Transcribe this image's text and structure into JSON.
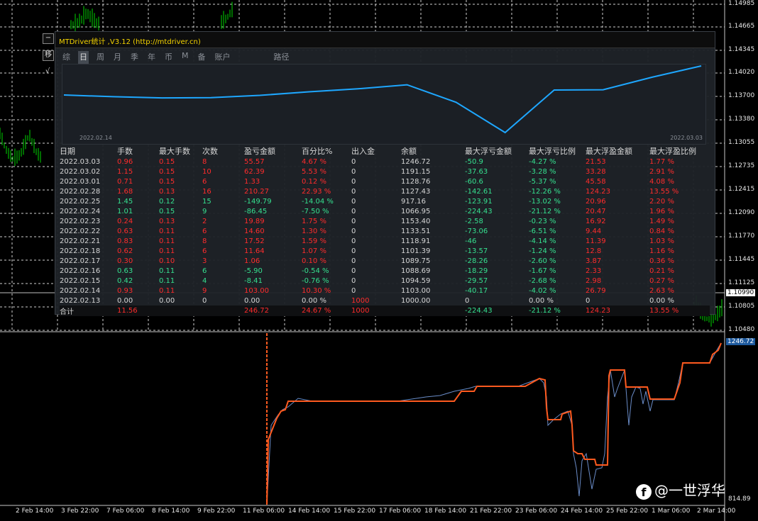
{
  "price_axis": {
    "labels": [
      "1.14985",
      "1.14665",
      "1.14345",
      "1.14020",
      "1.13700",
      "1.13380",
      "1.13055",
      "1.12735",
      "1.12415",
      "1.12090",
      "1.11770",
      "1.11445",
      "1.11125",
      "1.10805",
      "1.10480"
    ],
    "current_price": "1.10990"
  },
  "equity_axis": {
    "current": "1246.72",
    "min": "814.89"
  },
  "time_axis": [
    "2 Feb 14:00",
    "3 Feb 22:00",
    "7 Feb 06:00",
    "8 Feb 14:00",
    "9 Feb 22:00",
    "11 Feb 06:00",
    "14 Feb 14:00",
    "15 Feb 22:00",
    "17 Feb 06:00",
    "18 Feb 14:00",
    "21 Feb 22:00",
    "23 Feb 06:00",
    "24 Feb 14:00",
    "25 Feb 22:00",
    "1 Mar 06:00",
    "2 Mar 14:00"
  ],
  "side_buttons": [
    "−",
    "移",
    "√"
  ],
  "panel": {
    "title": "MTDriver统计 ,V3.12 (http://mtdriver.cn)",
    "tabs": [
      "综",
      "日",
      "周",
      "月",
      "季",
      "年",
      "币",
      "M",
      "备",
      "账户",
      "路径"
    ],
    "active_tab": "日",
    "mini_chart": {
      "start_date": "2022.02.14",
      "end_date": "2022.03.03",
      "line_color": "#1ea7ff"
    },
    "table": {
      "headers": [
        "日期",
        "手数",
        "最大手数",
        "次数",
        "盈亏金额",
        "百分比%",
        "出入金",
        "余额",
        "最大浮亏金额",
        "最大浮亏比例",
        "最大浮盈金额",
        "最大浮盈比例"
      ],
      "rows": [
        {
          "cells": [
            "2022.03.03",
            "0.96",
            "0.15",
            "8",
            "55.57",
            "4.67 %",
            "0",
            "1246.72",
            "-50.9",
            "-4.27 %",
            "21.53",
            "1.77 %"
          ],
          "sign": "pos"
        },
        {
          "cells": [
            "2022.03.02",
            "1.15",
            "0.15",
            "10",
            "62.39",
            "5.53 %",
            "0",
            "1191.15",
            "-37.63",
            "-3.28 %",
            "33.28",
            "2.91 %"
          ],
          "sign": "pos"
        },
        {
          "cells": [
            "2022.03.01",
            "0.71",
            "0.15",
            "6",
            "1.33",
            "0.12 %",
            "0",
            "1128.76",
            "-60.6",
            "-5.37 %",
            "45.58",
            "4.08 %"
          ],
          "sign": "pos"
        },
        {
          "cells": [
            "2022.02.28",
            "1.68",
            "0.13",
            "16",
            "210.27",
            "22.93 %",
            "0",
            "1127.43",
            "-142.61",
            "-12.26 %",
            "124.23",
            "13.55 %"
          ],
          "sign": "pos"
        },
        {
          "cells": [
            "2022.02.25",
            "1.45",
            "0.12",
            "15",
            "-149.79",
            "-14.04 %",
            "0",
            "917.16",
            "-123.91",
            "-13.02 %",
            "20.96",
            "2.20 %"
          ],
          "sign": "neg"
        },
        {
          "cells": [
            "2022.02.24",
            "1.01",
            "0.15",
            "9",
            "-86.45",
            "-7.50 %",
            "0",
            "1066.95",
            "-224.43",
            "-21.12 %",
            "20.47",
            "1.96 %"
          ],
          "sign": "neg"
        },
        {
          "cells": [
            "2022.02.23",
            "0.24",
            "0.13",
            "2",
            "19.89",
            "1.75 %",
            "0",
            "1153.40",
            "-2.58",
            "-0.23 %",
            "16.92",
            "1.49 %"
          ],
          "sign": "pos"
        },
        {
          "cells": [
            "2022.02.22",
            "0.63",
            "0.11",
            "6",
            "14.60",
            "1.30 %",
            "0",
            "1133.51",
            "-73.06",
            "-6.51 %",
            "9.44",
            "0.84 %"
          ],
          "sign": "pos"
        },
        {
          "cells": [
            "2022.02.21",
            "0.83",
            "0.11",
            "8",
            "17.52",
            "1.59 %",
            "0",
            "1118.91",
            "-46",
            "-4.14 %",
            "11.39",
            "1.03 %"
          ],
          "sign": "pos"
        },
        {
          "cells": [
            "2022.02.18",
            "0.62",
            "0.11",
            "6",
            "11.64",
            "1.07 %",
            "0",
            "1101.39",
            "-13.57",
            "-1.24 %",
            "12.8",
            "1.16 %"
          ],
          "sign": "pos"
        },
        {
          "cells": [
            "2022.02.17",
            "0.30",
            "0.10",
            "3",
            "1.06",
            "0.10 %",
            "0",
            "1089.75",
            "-28.26",
            "-2.60 %",
            "3.87",
            "0.36 %"
          ],
          "sign": "pos"
        },
        {
          "cells": [
            "2022.02.16",
            "0.63",
            "0.11",
            "6",
            "-5.90",
            "-0.54 %",
            "0",
            "1088.69",
            "-18.29",
            "-1.67 %",
            "2.33",
            "0.21 %"
          ],
          "sign": "neg"
        },
        {
          "cells": [
            "2022.02.15",
            "0.42",
            "0.11",
            "4",
            "-8.41",
            "-0.76 %",
            "0",
            "1094.59",
            "-29.57",
            "-2.68 %",
            "2.98",
            "0.27 %"
          ],
          "sign": "neg"
        },
        {
          "cells": [
            "2022.02.14",
            "0.93",
            "0.11",
            "9",
            "103.00",
            "10.30 %",
            "0",
            "1103.00",
            "-40.17",
            "-4.02 %",
            "26.79",
            "2.63 %"
          ],
          "sign": "pos"
        },
        {
          "cells": [
            "2022.02.13",
            "0.00",
            "0.00",
            "0",
            "0.00",
            "0.00 %",
            "1000",
            "1000.00",
            "0",
            "0.00 %",
            "0",
            "0.00 %"
          ],
          "sign": "zero"
        }
      ],
      "total": [
        "合计",
        "11.56",
        "",
        "",
        "246.72",
        "24.67 %",
        "1000",
        "",
        "-224.43",
        "-21.12 %",
        "124.23",
        "13.55 %"
      ]
    }
  },
  "watermark": {
    "icon": "facebook-icon",
    "text": "@一世浮华"
  },
  "colors": {
    "bull_candle": "#00d800",
    "equity_line": "#ff5a1f",
    "balance_line": "#6a8cc8",
    "positive": "#ff2c2c",
    "negative": "#35e08f",
    "title": "#f5d400"
  }
}
